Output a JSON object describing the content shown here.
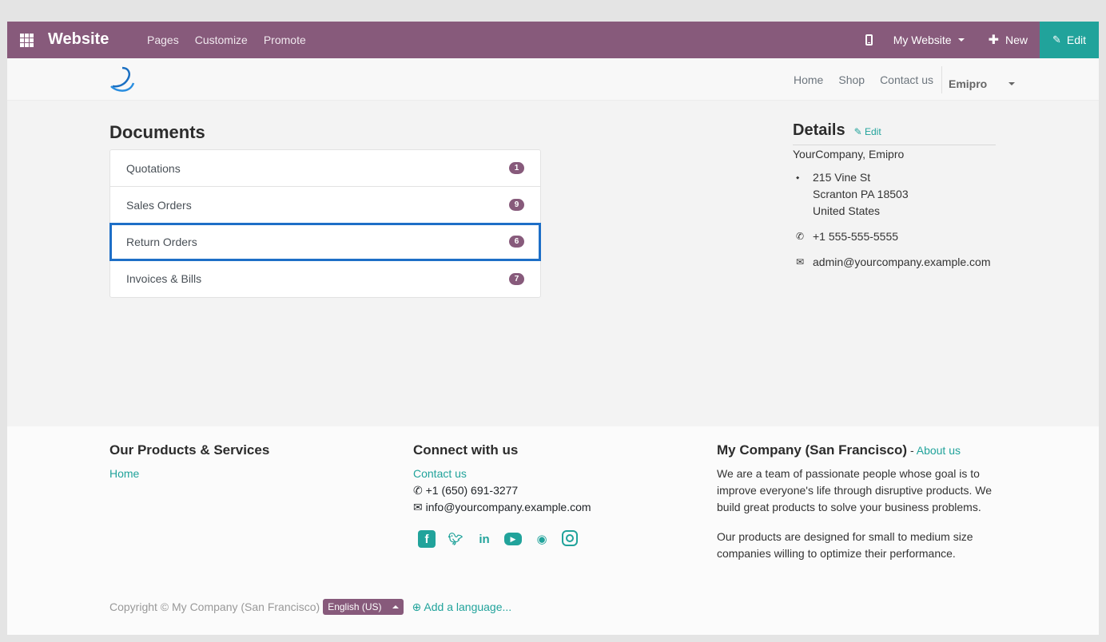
{
  "topbar": {
    "brand": "Website",
    "menu": [
      "Pages",
      "Customize",
      "Promote"
    ],
    "website_selector": "My Website",
    "new_label": "New",
    "edit_label": "Edit"
  },
  "site_nav": {
    "items": [
      "Home",
      "Shop",
      "Contact us"
    ],
    "user": "Emipro"
  },
  "documents": {
    "title": "Documents",
    "items": [
      {
        "label": "Quotations",
        "count": "1"
      },
      {
        "label": "Sales Orders",
        "count": "9"
      },
      {
        "label": "Return Orders",
        "count": "6"
      },
      {
        "label": "Invoices & Bills",
        "count": "7"
      }
    ]
  },
  "details": {
    "title": "Details",
    "edit_label": "Edit",
    "company": "YourCompany, Emipro",
    "address_line1": "215 Vine St",
    "address_line2": "Scranton PA 18503",
    "address_line3": "United States",
    "phone": "+1 555-555-5555",
    "email": "admin@yourcompany.example.com"
  },
  "footer": {
    "col1_title": "Our Products & Services",
    "col1_link": "Home",
    "col2_title": "Connect with us",
    "col2_link": "Contact us",
    "col2_phone": "+1 (650) 691-3277",
    "col2_email": "info@yourcompany.example.com",
    "col3_title": "My Company (San Francisco)",
    "col3_sep": " - ",
    "col3_link": "About us",
    "col3_p1": "We are a team of passionate people whose goal is to improve everyone's life through disruptive products. We build great products to solve your business problems.",
    "col3_p2": "Our products are designed for small to medium size companies willing to optimize their performance.",
    "copyright": "Copyright © My Company (San Francisco)",
    "language": "English (US)",
    "add_language": "Add a language..."
  },
  "colors": {
    "topbar": "#875a7b",
    "accent": "#21a39b",
    "highlight": "#1e6fc7"
  }
}
